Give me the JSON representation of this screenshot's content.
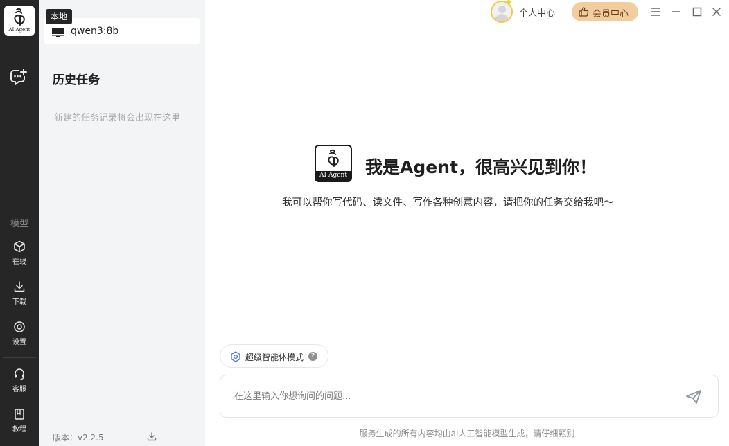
{
  "rail": {
    "logo_text": "AI Agent",
    "section_label": "模型",
    "items": [
      {
        "label": "在线",
        "icon": "cube-icon"
      },
      {
        "label": "下载",
        "icon": "download-icon"
      },
      {
        "label": "设置",
        "icon": "settings-icon"
      },
      {
        "label": "客服",
        "icon": "headset-icon"
      },
      {
        "label": "教程",
        "icon": "book-icon"
      }
    ]
  },
  "panel": {
    "model_tag": "本地",
    "model_name": "qwen3:8b",
    "history_title": "历史任务",
    "empty_hint": "新建的任务记录将会出现在这里",
    "version": "版本：v2.2.5"
  },
  "topbar": {
    "profile_label": "个人中心",
    "vip_label": "会员中心"
  },
  "hero": {
    "logo_text": "AI Agent",
    "title": "我是Agent，很高兴见到你！",
    "subtitle": "我可以帮你写代码、读文件、写作各种创意内容，请把你的任务交给我吧～"
  },
  "mode_chip": {
    "label": "超级智能体模式",
    "help": "?"
  },
  "input": {
    "placeholder": "在这里输入你想询问的问题...",
    "value": ""
  },
  "disclaimer": "服务生成的所有内容均由ai人工智能模型生成，请仔细甄别",
  "colors": {
    "rail_bg": "#262626",
    "panel_bg": "#f3f4f6",
    "vip_bg": "#f1cda0",
    "avatar_ring": "#f2c94c"
  }
}
